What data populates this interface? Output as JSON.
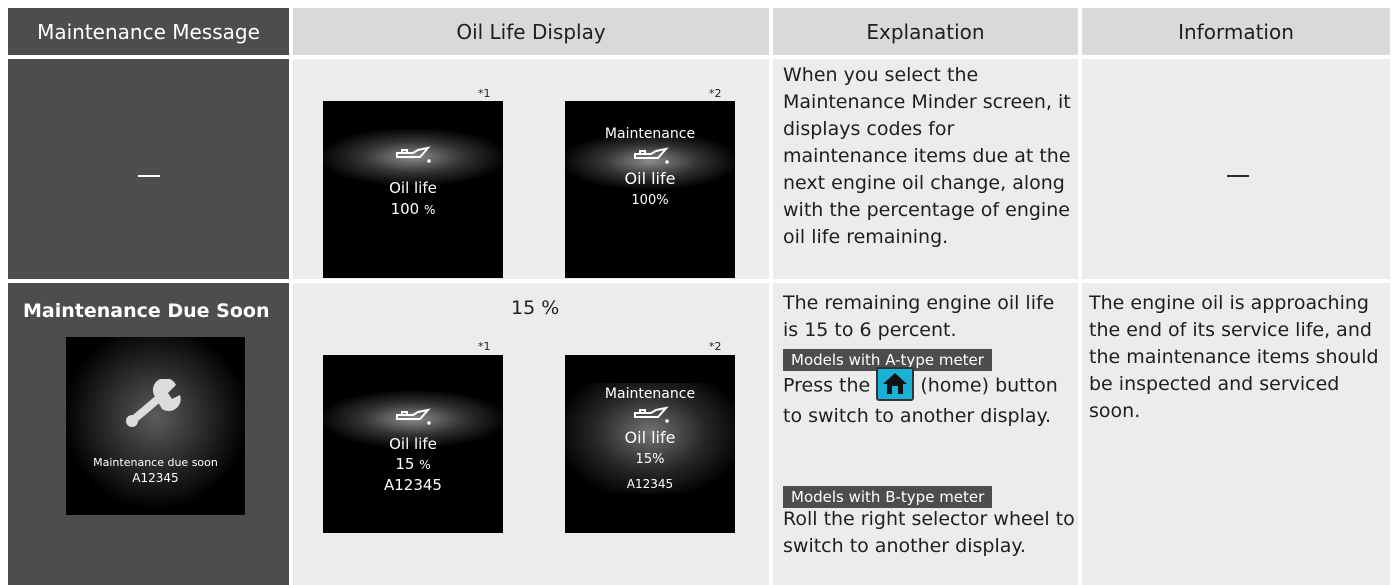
{
  "headers": {
    "maintenance_message": "Maintenance Message",
    "oil_life_display": "Oil Life Display",
    "explanation": "Explanation",
    "information": "Information"
  },
  "footnotes": {
    "star1": "*1",
    "star2": "*2"
  },
  "row1": {
    "screen_a": {
      "title": "Oil life",
      "value": "100",
      "unit": "%"
    },
    "screen_b": {
      "header": "Maintenance",
      "title": "Oil life",
      "value": "100%"
    },
    "explanation": "When you select the Maintenance Minder screen, it displays codes for maintenance items due at the next engine oil change, along with the percentage of engine oil life remaining."
  },
  "row2": {
    "message_title": "Maintenance Due Soon",
    "message_screen_line1": "Maintenance due soon",
    "message_screen_line2": "A12345",
    "percent_label": "15 %",
    "screen_a": {
      "title": "Oil life",
      "value": "15",
      "unit": "%",
      "code": "A12345"
    },
    "screen_b": {
      "header": "Maintenance",
      "title": "Oil life",
      "value": "15%",
      "code": "A12345"
    },
    "explanation_intro": "The remaining engine oil life is 15 to 6 percent.",
    "badge_a": "Models with A-type meter",
    "press_text_before": "Press the",
    "press_text_after": "(home)",
    "press_text_rest": "button to switch to another display.",
    "badge_b": "Models with B-type meter",
    "roll_text": "Roll the right selector wheel to switch to another display.",
    "information": "The engine oil is approaching the end of its service life, and the maintenance items should be inspected and serviced soon."
  }
}
